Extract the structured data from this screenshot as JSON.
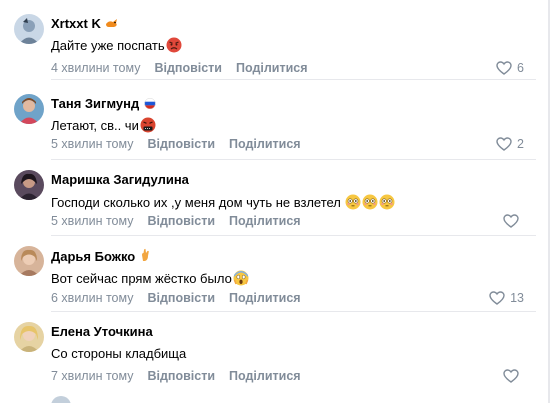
{
  "comments": [
    {
      "author": "Xrtxxt K",
      "text": "Дайте уже поспать",
      "time": "4 хвилини тому",
      "reply": "Відповісти",
      "share": "Поділитися",
      "likes": "6",
      "avatar_color": "#c9d7e6",
      "badge_icon": "fox-icon",
      "emoji": "angry-face-icon"
    },
    {
      "author": "Таня Зигмунд",
      "text": "Летают, св.. чи",
      "time": "5 хвилин тому",
      "reply": "Відповісти",
      "share": "Поділитися",
      "likes": "2",
      "avatar_color": "#6fa3c9",
      "badge_icon": "russia-flag-icon",
      "emoji": "cursing-face-icon"
    },
    {
      "author": "Маришка Загидулина",
      "text": "Господи сколько их ,у меня дом чуть не взлетел",
      "time": "5 хвилин тому",
      "reply": "Відповісти",
      "share": "Поділитися",
      "likes": "",
      "avatar_color": "#5a4a5e",
      "badge_icon": "",
      "emoji": "flushed-face-icon"
    },
    {
      "author": "Дарья Божко",
      "text": "Вот сейчас прям жёстко было",
      "time": "6 хвилин тому",
      "reply": "Відповісти",
      "share": "Поділитися",
      "likes": "13",
      "avatar_color": "#d7b49a",
      "badge_icon": "crossed-fingers-icon",
      "emoji": "screaming-face-icon"
    },
    {
      "author": "Елена Уточкина",
      "text": "Со стороны кладбища",
      "time": "7 хвилин тому",
      "reply": "Відповісти",
      "share": "Поділитися",
      "likes": "",
      "avatar_color": "#e6d3a3",
      "badge_icon": "",
      "emoji": ""
    }
  ],
  "colors": {
    "meta": "#818c99",
    "separator": "#e7e8ec",
    "name": "#000000"
  }
}
